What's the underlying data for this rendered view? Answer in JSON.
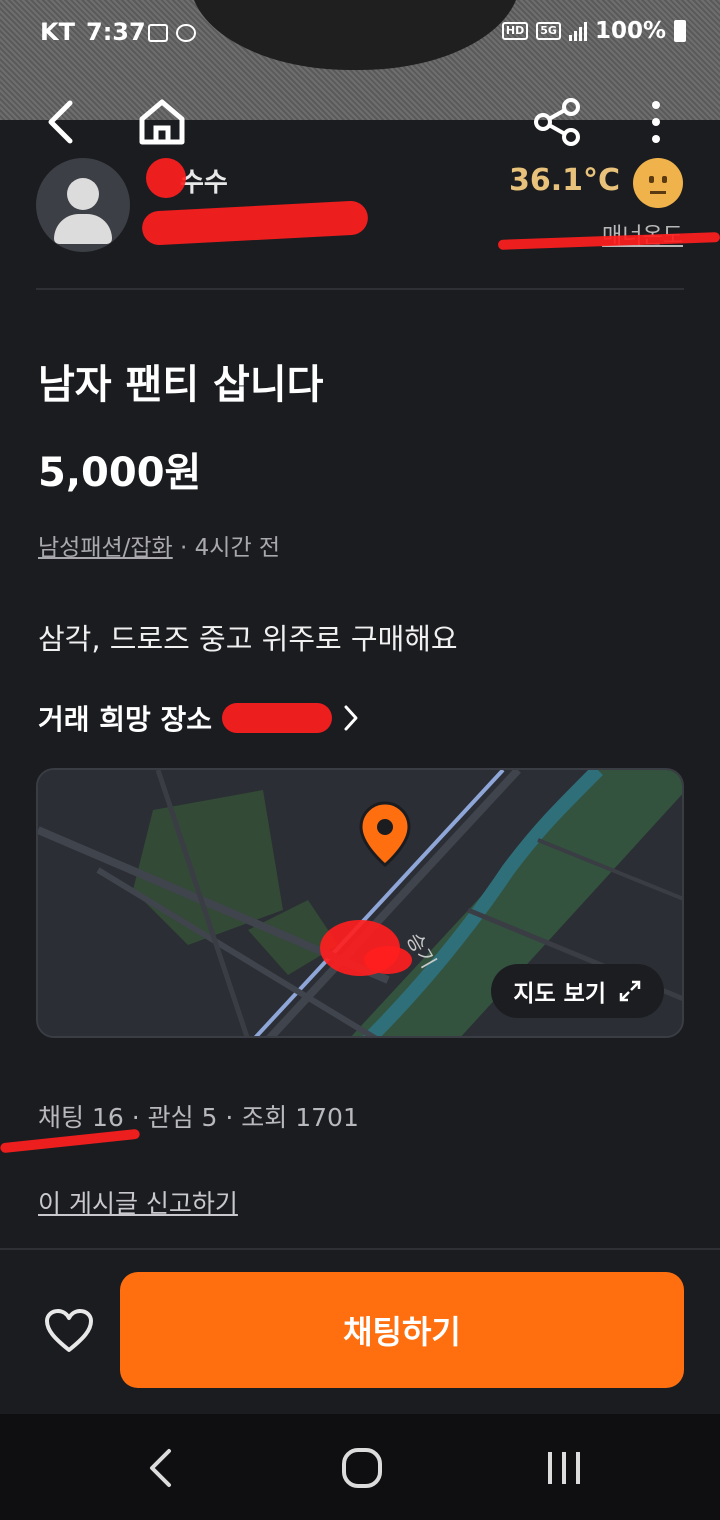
{
  "status": {
    "carrier": "KT",
    "time": "7:37",
    "net_hd": "HD",
    "net_5g": "5G",
    "battery": "100%"
  },
  "nav": {
    "back_icon": "chevron-left-icon",
    "home_icon": "home-icon",
    "share_icon": "share-icon",
    "more_icon": "more-vertical-icon"
  },
  "profile": {
    "nickname": "수수",
    "temperature": "36.1°C",
    "manner_label": "매너온도"
  },
  "post": {
    "title": "남자 팬티 삽니다",
    "price": "5,000원",
    "category": "남성패션/잡화",
    "time_sep": " · ",
    "posted": "4시간 전",
    "description": "삼각, 드로즈 중고 위주로 구매해요",
    "place_label": "거래 희망 장소"
  },
  "map": {
    "view_label": "지도 보기",
    "stream_label": "승기"
  },
  "stats": {
    "text": "채팅 16 · 관심 5 · 조회 1701"
  },
  "report": {
    "label": "이 게시글 신고하기"
  },
  "actions": {
    "chat_label": "채팅하기"
  },
  "colors": {
    "accent": "#ff6f0f",
    "background": "#1b1c20",
    "temperature": "#e8c27a"
  }
}
